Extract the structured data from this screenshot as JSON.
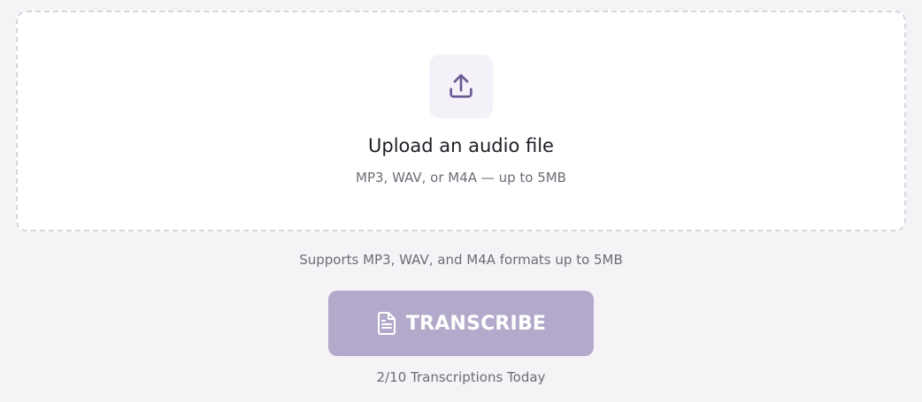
{
  "upload": {
    "icon": "upload-icon",
    "title": "Upload an audio file",
    "subtitle": "MP3, WAV, or M4A — up to 5MB"
  },
  "formats_note": "Supports MP3, WAV, and M4A formats up to 5MB",
  "transcribe_button": {
    "icon": "document-icon",
    "label": "TRANSCRIBE",
    "color": "#b3aacb",
    "state": "disabled"
  },
  "usage": {
    "text": "2/10 Transcriptions Today"
  },
  "colors": {
    "background": "#f5f3f6",
    "accent": "#6b5a93",
    "icon_bg": "#f4f1f9"
  }
}
